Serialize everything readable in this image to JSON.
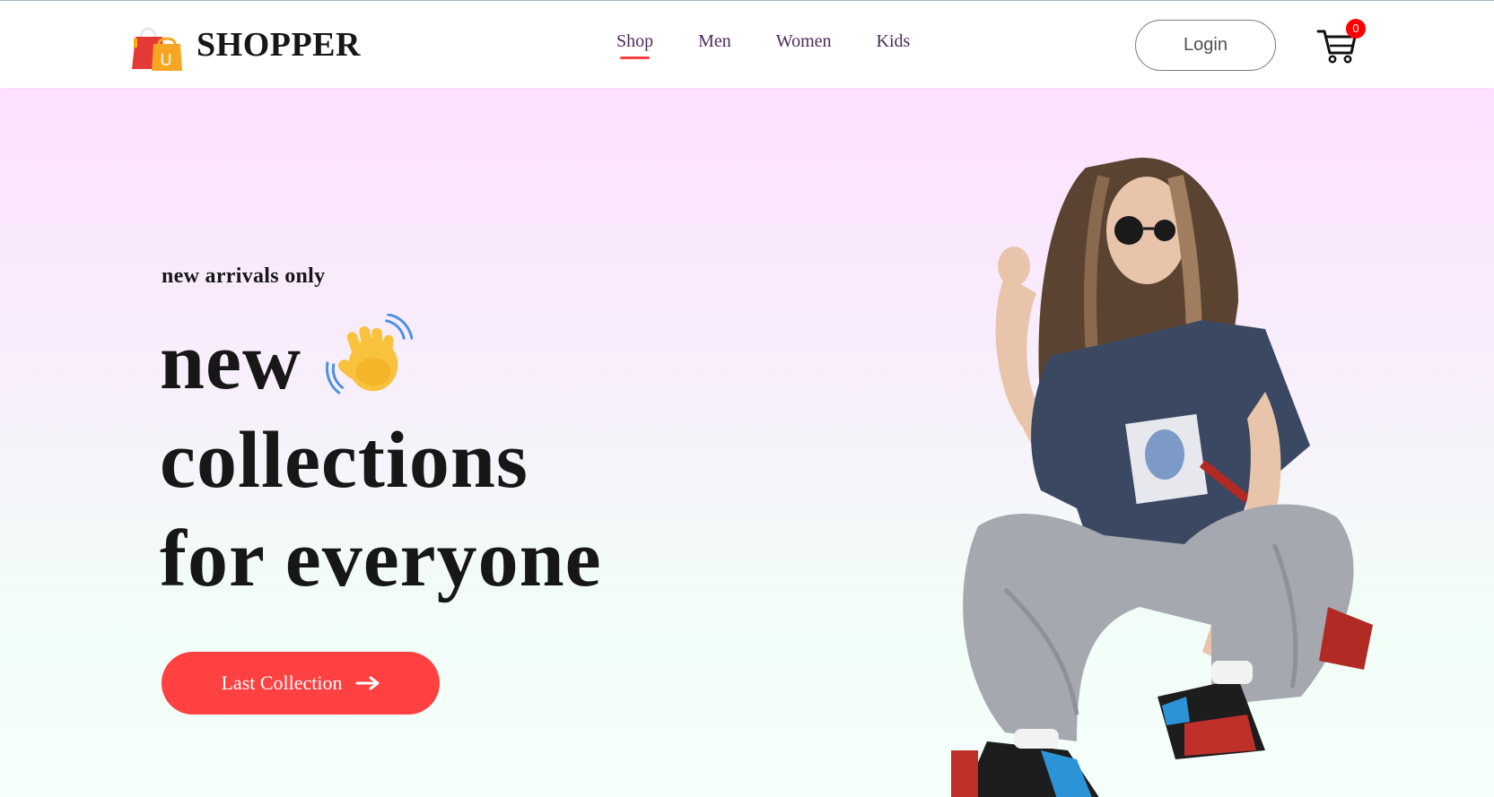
{
  "navbar": {
    "brand_name": "SHOPPER",
    "logo_letter": "U",
    "menu": [
      {
        "label": "Shop",
        "active": true
      },
      {
        "label": "Men",
        "active": false
      },
      {
        "label": "Women",
        "active": false
      },
      {
        "label": "Kids",
        "active": false
      }
    ],
    "login_label": "Login",
    "cart_count": "0"
  },
  "hero": {
    "eyebrow": "new arrivals only",
    "headline_line1": "new",
    "headline_line2": "collections",
    "headline_line3": "for everyone",
    "cta_label": "Last Collection",
    "hand_icon": "waving-hand-icon",
    "arrow_icon": "arrow-right-icon",
    "image": "hero-model-image"
  },
  "colors": {
    "accent": "#ff4141",
    "badge": "#ff0000",
    "text": "#171717",
    "nav_text": "#4b2a5c",
    "hero_top": "#fde1ff",
    "hero_bottom": "#f4fffb"
  }
}
